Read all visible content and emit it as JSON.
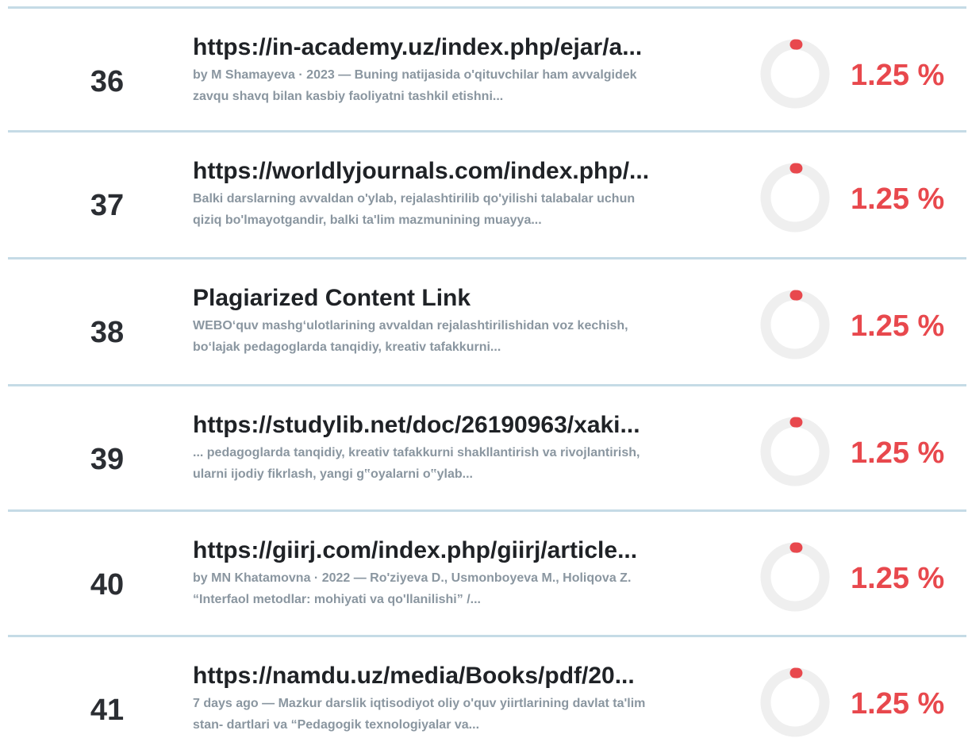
{
  "results": [
    {
      "number": "36",
      "title": "https://in-academy.uz/index.php/ejar/a...",
      "snippet": "by M Shamayeva · 2023 — Buning natijasida o'qituvchilar ham avvalgidek zavqu shavq bilan kasbiy faoliyatni tashkil etishni...",
      "percent_label": "1.25 %",
      "percent_value": 1.25
    },
    {
      "number": "37",
      "title": "https://worldlyjournals.com/index.php/...",
      "snippet": "Balki darslarning avvaldan o'ylab, rejalashtirilib qo'yilishi talabalar uchun qiziq bo'lmayotgandir, balki ta'lim mazmunining muayya...",
      "percent_label": "1.25 %",
      "percent_value": 1.25
    },
    {
      "number": "38",
      "title": "Plagiarized Content Link",
      "snippet": "WEBO‘quv mashg‘ulotlarining avvaldan rejalashtirilishidan voz kechish, bo‘lajak pedagoglarda tanqidiy, kreativ tafakkurni...",
      "percent_label": "1.25 %",
      "percent_value": 1.25
    },
    {
      "number": "39",
      "title": "https://studylib.net/doc/26190963/xaki...",
      "snippet": "... pedagoglarda tanqidiy, kreativ tafakkurni shakllantirish va rivojlantirish, ularni ijodiy fikrlash, yangi g‟oyalarni o‟ylab...",
      "percent_label": "1.25 %",
      "percent_value": 1.25
    },
    {
      "number": "40",
      "title": "https://giirj.com/index.php/giirj/article...",
      "snippet": "by MN Khatamovna · 2022 — Ro'ziyeva D., Usmonboyeva M., Holiqova Z. “Interfaol metodlar: mohiyati va qo'llanilishi” /...",
      "percent_label": "1.25 %",
      "percent_value": 1.25
    },
    {
      "number": "41",
      "title": "https://namdu.uz/media/Books/pdf/20...",
      "snippet": "7 days ago — Mazkur darslik iqtisodiyot oliy o'quv yiirtlarining davlat ta'lim stan- dartlari va “Pedagogik texnologiyalar va...",
      "percent_label": "1.25 %",
      "percent_value": 1.25
    }
  ],
  "colors": {
    "accent": "#e8484d",
    "track": "#efefef",
    "divider": "#c5dbe6"
  }
}
